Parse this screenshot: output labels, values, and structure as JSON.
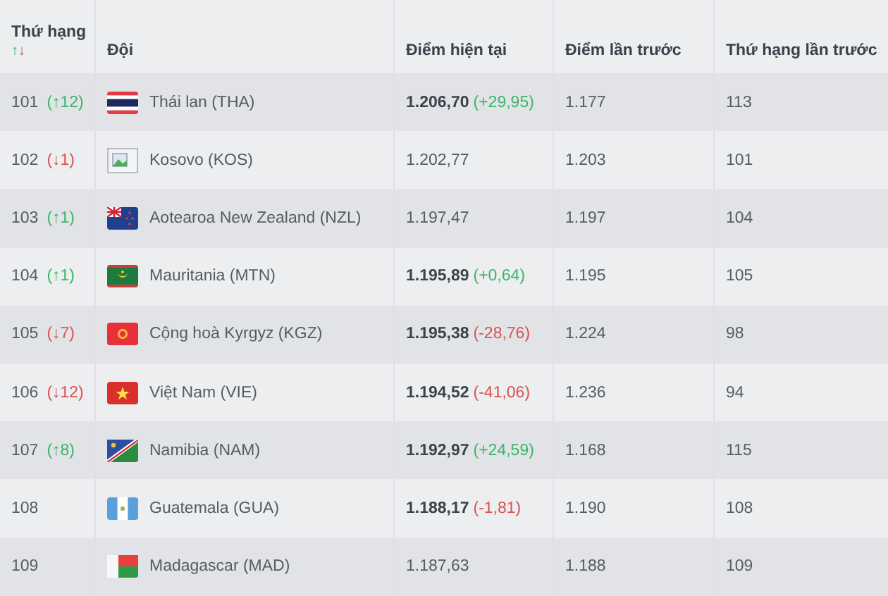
{
  "table": {
    "columns": [
      {
        "label": "Thứ hạng",
        "sort_up": "↑",
        "sort_down": "↓"
      },
      {
        "label": "Đội"
      },
      {
        "label": "Điểm hiện tại"
      },
      {
        "label": "Điểm lần trước"
      },
      {
        "label": "Thứ hạng lần trước"
      }
    ],
    "rows": [
      {
        "rank": "101",
        "change": {
          "text": "(↑12)",
          "kind": "up"
        },
        "flag": {
          "kind": "tha"
        },
        "team": "Thái lan (THA)",
        "points": "1.206,70",
        "delta": {
          "text": "(+29,95)",
          "kind": "up"
        },
        "prev_points": "1.177",
        "prev_rank": "113"
      },
      {
        "rank": "102",
        "change": {
          "text": "(↓1)",
          "kind": "down"
        },
        "flag": {
          "kind": "broken"
        },
        "team": "Kosovo (KOS)",
        "points": "1.202,77",
        "prev_points": "1.203",
        "prev_rank": "101"
      },
      {
        "rank": "103",
        "change": {
          "text": "(↑1)",
          "kind": "up"
        },
        "flag": {
          "kind": "nzl"
        },
        "team": "Aotearoa New Zealand (NZL)",
        "points": "1.197,47",
        "prev_points": "1.197",
        "prev_rank": "104"
      },
      {
        "rank": "104",
        "change": {
          "text": "(↑1)",
          "kind": "up"
        },
        "flag": {
          "kind": "mtn"
        },
        "team": "Mauritania (MTN)",
        "points": "1.195,89",
        "delta": {
          "text": "(+0,64)",
          "kind": "up"
        },
        "prev_points": "1.195",
        "prev_rank": "105"
      },
      {
        "rank": "105",
        "change": {
          "text": "(↓7)",
          "kind": "down"
        },
        "flag": {
          "kind": "kgz"
        },
        "team": "Cộng hoà Kyrgyz (KGZ)",
        "points": "1.195,38",
        "delta": {
          "text": "(-28,76)",
          "kind": "down"
        },
        "prev_points": "1.224",
        "prev_rank": "98"
      },
      {
        "rank": "106",
        "change": {
          "text": "(↓12)",
          "kind": "down"
        },
        "flag": {
          "kind": "vie"
        },
        "team": "Việt Nam (VIE)",
        "points": "1.194,52",
        "delta": {
          "text": "(-41,06)",
          "kind": "down"
        },
        "prev_points": "1.236",
        "prev_rank": "94"
      },
      {
        "rank": "107",
        "change": {
          "text": "(↑8)",
          "kind": "up"
        },
        "flag": {
          "kind": "nam"
        },
        "team": "Namibia (NAM)",
        "points": "1.192,97",
        "delta": {
          "text": "(+24,59)",
          "kind": "up"
        },
        "prev_points": "1.168",
        "prev_rank": "115"
      },
      {
        "rank": "108",
        "flag": {
          "kind": "gua"
        },
        "team": "Guatemala (GUA)",
        "points": "1.188,17",
        "delta": {
          "text": "(-1,81)",
          "kind": "down"
        },
        "prev_points": "1.190",
        "prev_rank": "108"
      },
      {
        "rank": "109",
        "flag": {
          "kind": "mad"
        },
        "team": "Madagascar (MAD)",
        "points": "1.187,63",
        "prev_points": "1.188",
        "prev_rank": "109"
      }
    ]
  }
}
